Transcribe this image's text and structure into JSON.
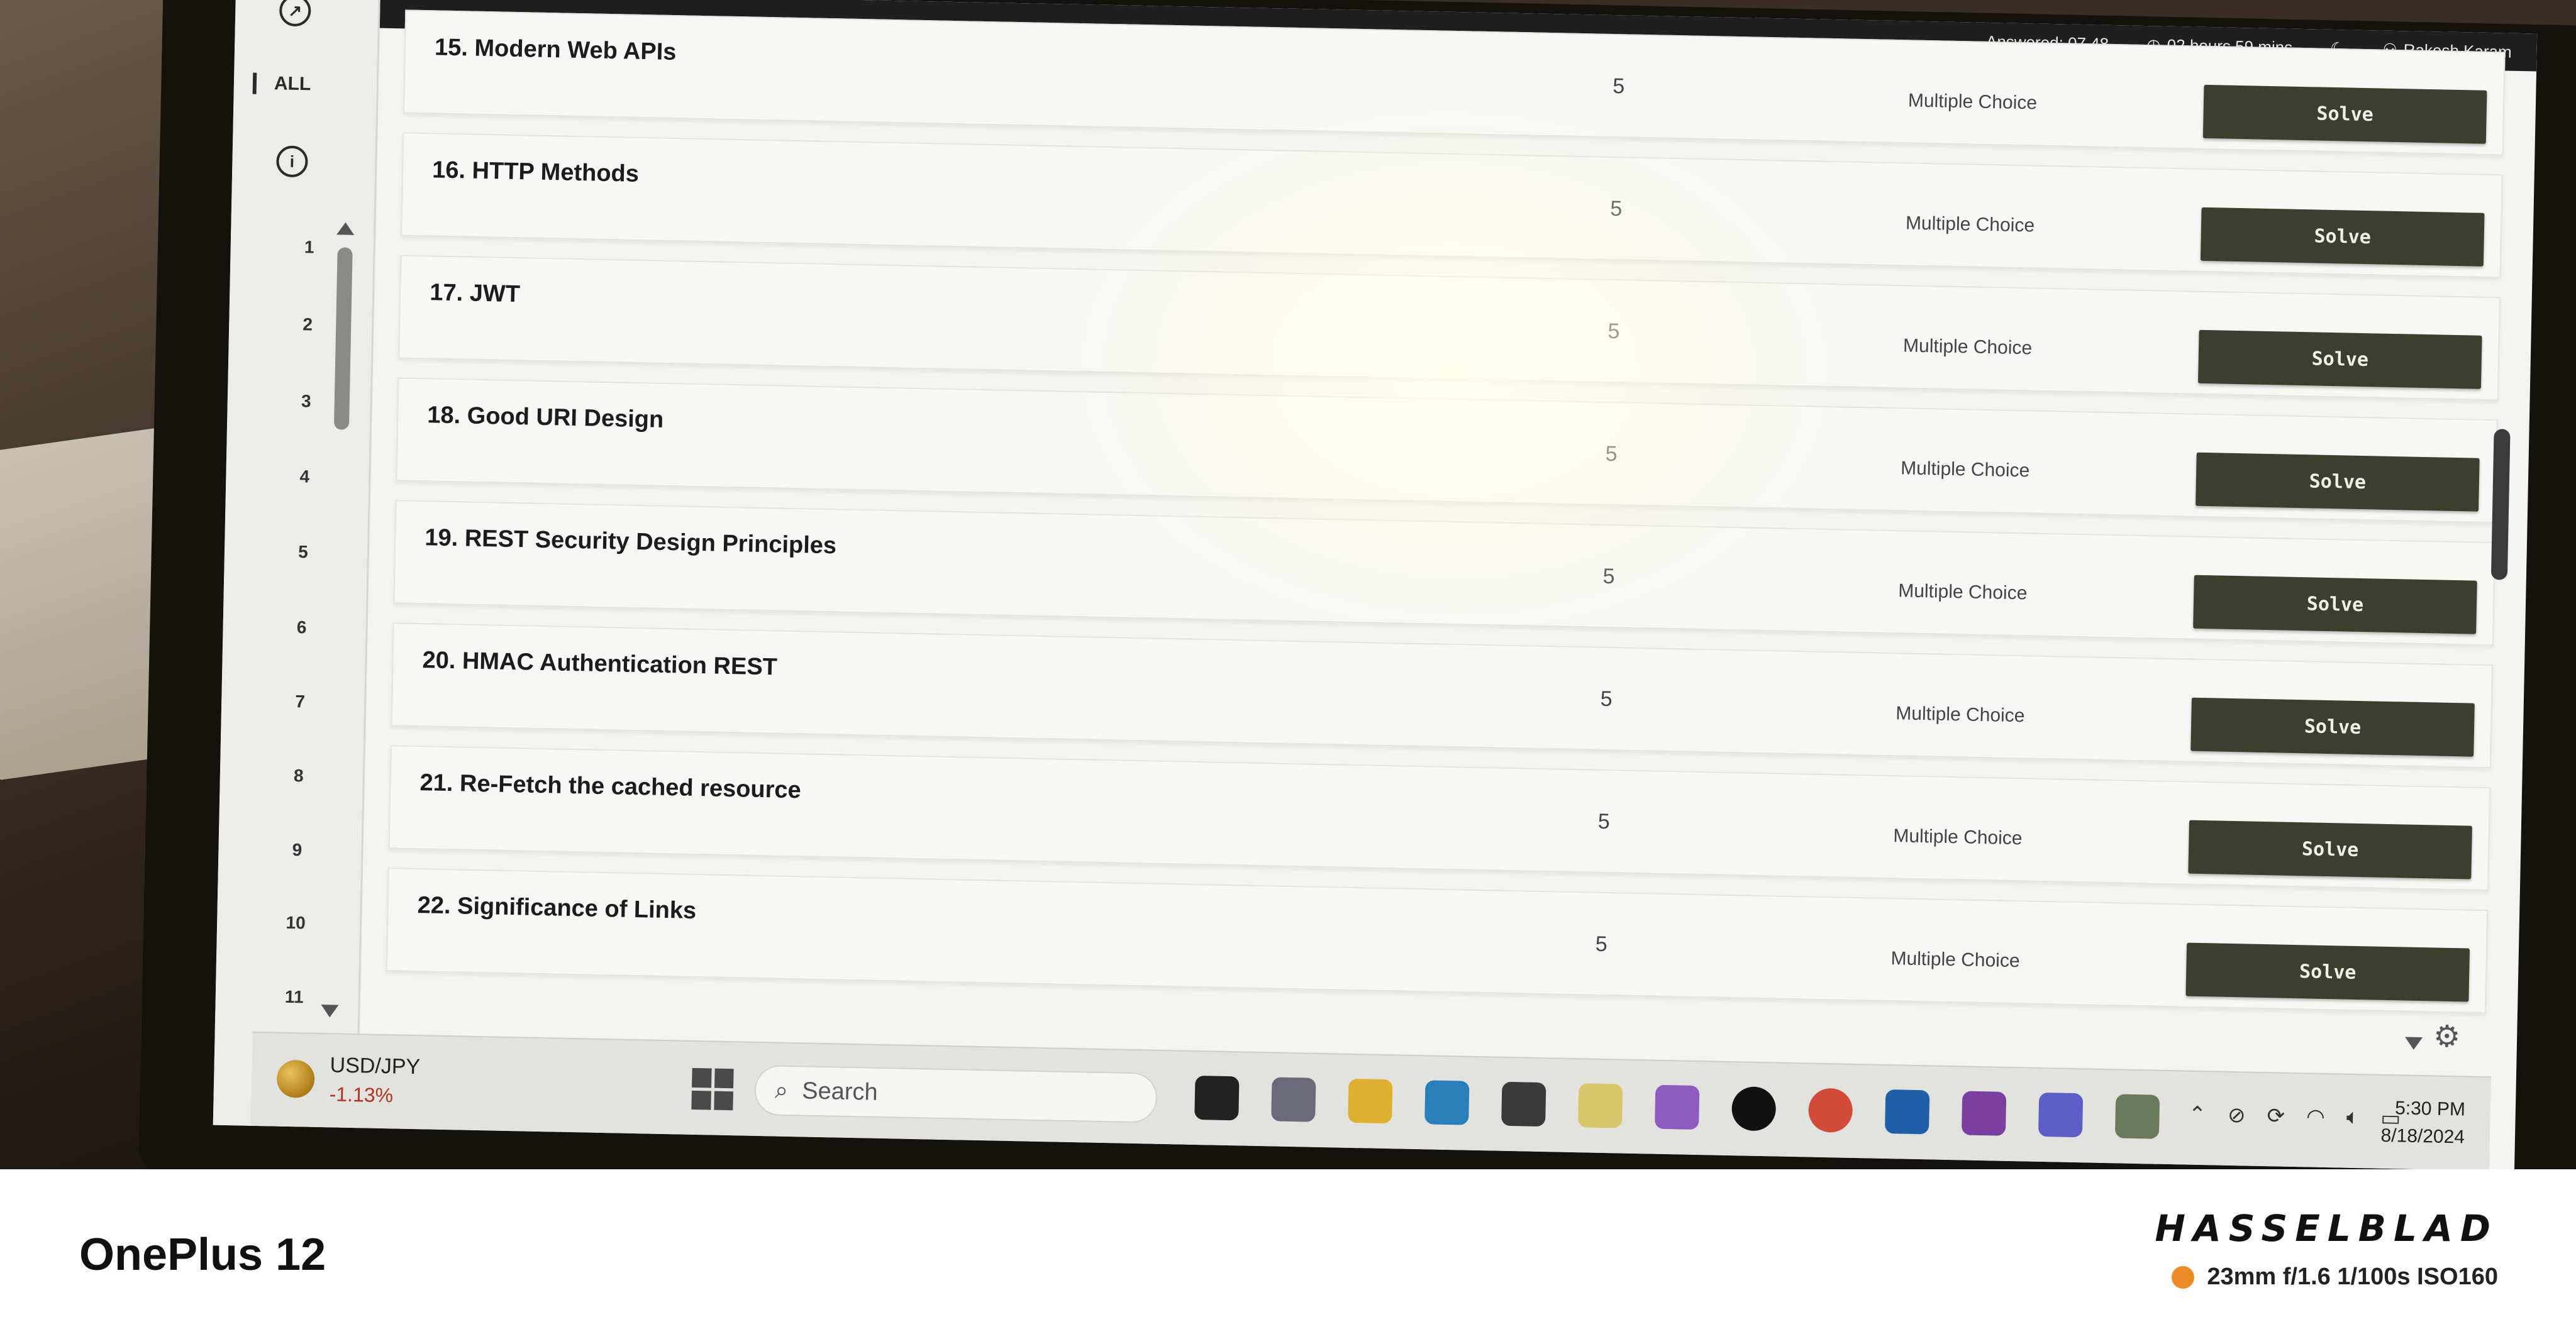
{
  "header": {
    "answered": "Answered: 07 48",
    "timer": "02 hours 59 mins",
    "user": "Rakesh Karam"
  },
  "rail": {
    "all_label": "ALL",
    "numbers": [
      "1",
      "2",
      "3",
      "4",
      "5",
      "6",
      "7",
      "8",
      "9",
      "10",
      "11"
    ]
  },
  "questions": [
    {
      "title": "15. Modern Web APIs",
      "score": "5",
      "type": "Multiple Choice",
      "action": "Solve"
    },
    {
      "title": "16. HTTP Methods",
      "score": "5",
      "type": "Multiple Choice",
      "action": "Solve"
    },
    {
      "title": "17. JWT",
      "score": "5",
      "type": "Multiple Choice",
      "action": "Solve"
    },
    {
      "title": "18. Good URI Design",
      "score": "5",
      "type": "Multiple Choice",
      "action": "Solve"
    },
    {
      "title": "19. REST Security Design Principles",
      "score": "5",
      "type": "Multiple Choice",
      "action": "Solve"
    },
    {
      "title": "20. HMAC Authentication REST",
      "score": "5",
      "type": "Multiple Choice",
      "action": "Solve"
    },
    {
      "title": "21. Re-Fetch the cached resource",
      "score": "5",
      "type": "Multiple Choice",
      "action": "Solve"
    },
    {
      "title": "22. Significance of Links",
      "score": "5",
      "type": "Multiple Choice",
      "action": "Solve"
    }
  ],
  "taskbar": {
    "ticker_name": "USD/JPY",
    "ticker_change": "-1.13%",
    "search_placeholder": "Search",
    "time": "5:30 PM",
    "date": "8/18/2024"
  },
  "footer": {
    "device": "OnePlus 12",
    "brand": "HASSELBLAD",
    "exif": "23mm  f/1.6  1/100s  ISO160"
  },
  "colors": {
    "solve_button": "#3c3f2e",
    "exif_dot": "#f08a24",
    "ticker_negative": "#b2331f"
  }
}
